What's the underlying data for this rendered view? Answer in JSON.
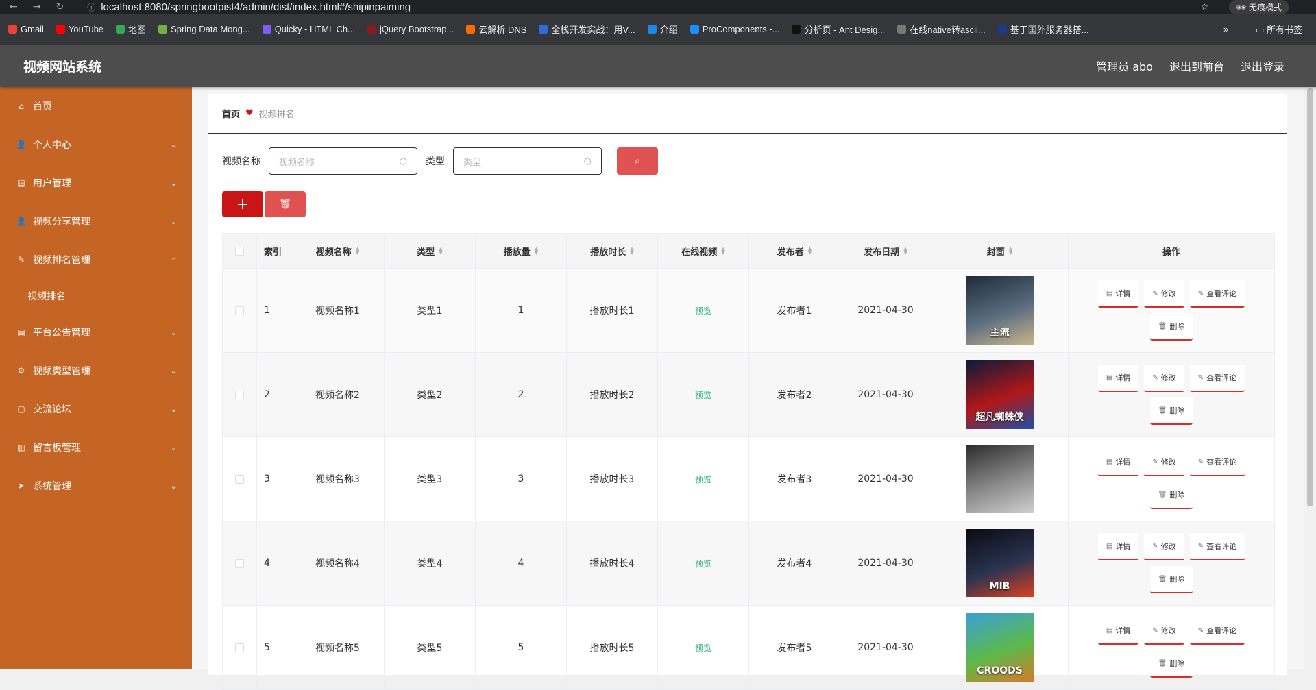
{
  "browser": {
    "url": "localhost:8080/springbootpist4/admin/dist/index.html#/shipinpaiming",
    "incognito_label": "无痕模式",
    "bookmarks": [
      {
        "label": "Gmail",
        "color": "#ea4335"
      },
      {
        "label": "YouTube",
        "color": "#ff0000"
      },
      {
        "label": "地图",
        "color": "#34a853"
      },
      {
        "label": "Spring Data Mong...",
        "color": "#6db33f"
      },
      {
        "label": "Quicky - HTML Ch...",
        "color": "#7b5cf5"
      },
      {
        "label": "jQuery Bootstrap...",
        "color": "#8b1a1a"
      },
      {
        "label": "云解析 DNS",
        "color": "#ff6a00"
      },
      {
        "label": "全栈开发实战：用V...",
        "color": "#2d6cdf"
      },
      {
        "label": "介绍",
        "color": "#1e88e5"
      },
      {
        "label": "ProComponents -...",
        "color": "#1890ff"
      },
      {
        "label": "分析页 - Ant Desig...",
        "color": "#111111"
      },
      {
        "label": "在线native转ascii...",
        "color": "#777777"
      },
      {
        "label": "基于国外服务器搭...",
        "color": "#1a3a8a"
      }
    ],
    "all_bookmarks_label": "所有书签"
  },
  "header": {
    "title": "视频网站系统",
    "admin_label": "管理员 abo",
    "to_front_label": "退出到前台",
    "logout_label": "退出登录"
  },
  "sidebar": {
    "items": [
      {
        "label": "首页",
        "icon": "home-icon",
        "glyph": "⌂",
        "has_children": false
      },
      {
        "label": "个人中心",
        "icon": "user-icon",
        "glyph": "👤",
        "has_children": true
      },
      {
        "label": "用户管理",
        "icon": "id-card-icon",
        "glyph": "▤",
        "has_children": true
      },
      {
        "label": "视频分享管理",
        "icon": "user-icon",
        "glyph": "👤",
        "has_children": true
      },
      {
        "label": "视频排名管理",
        "icon": "edit-icon",
        "glyph": "✎",
        "has_children": true,
        "expanded": true
      },
      {
        "label": "平台公告管理",
        "icon": "notice-icon",
        "glyph": "▤",
        "has_children": true
      },
      {
        "label": "视频类型管理",
        "icon": "settings-icon",
        "glyph": "⚙",
        "has_children": true
      },
      {
        "label": "交流论坛",
        "icon": "chat-icon",
        "glyph": "▢",
        "has_children": true
      },
      {
        "label": "留言板管理",
        "icon": "bar-chart-icon",
        "glyph": "▥",
        "has_children": true
      },
      {
        "label": "系统管理",
        "icon": "send-icon",
        "glyph": "➤",
        "has_children": true
      }
    ],
    "sub_item_label": "视频排名"
  },
  "breadcrumb": {
    "home": "首页",
    "current": "视频排名"
  },
  "search": {
    "name_label": "视频名称",
    "name_placeholder": "视频名称",
    "type_label": "类型",
    "type_placeholder": "类型"
  },
  "table": {
    "headers": {
      "index": "索引",
      "name": "视频名称",
      "type": "类型",
      "plays": "播放量",
      "duration": "播放时长",
      "online": "在线视频",
      "publisher": "发布者",
      "date": "发布日期",
      "cover": "封面",
      "ops": "操作"
    },
    "op_labels": {
      "detail": "详情",
      "edit": "修改",
      "comments": "查看评论",
      "delete": "删除"
    },
    "rows": [
      {
        "index": "1",
        "name": "视频名称1",
        "type": "类型1",
        "plays": "1",
        "duration": "播放时长1",
        "online": "预览",
        "publisher": "发布者1",
        "date": "2021-04-30",
        "cover_text": "主流",
        "cover_colors": [
          "#1e2a38",
          "#5b6d80",
          "#c9b48a"
        ]
      },
      {
        "index": "2",
        "name": "视频名称2",
        "type": "类型2",
        "plays": "2",
        "duration": "播放时长2",
        "online": "预览",
        "publisher": "发布者2",
        "date": "2021-04-30",
        "cover_text": "超凡蜘蛛侠",
        "cover_colors": [
          "#0b1a3a",
          "#b01818",
          "#1e4fa3"
        ]
      },
      {
        "index": "3",
        "name": "视频名称3",
        "type": "类型3",
        "plays": "3",
        "duration": "播放时长3",
        "online": "预览",
        "publisher": "发布者3",
        "date": "2021-04-30",
        "cover_text": "",
        "cover_colors": [
          "#2b2b2b",
          "#8a8a8a",
          "#d0d0d0"
        ]
      },
      {
        "index": "4",
        "name": "视频名称4",
        "type": "类型4",
        "plays": "4",
        "duration": "播放时长4",
        "online": "预览",
        "publisher": "发布者4",
        "date": "2021-04-30",
        "cover_text": "MIB",
        "cover_colors": [
          "#0a0a12",
          "#2a3350",
          "#e04020"
        ]
      },
      {
        "index": "5",
        "name": "视频名称5",
        "type": "类型5",
        "plays": "5",
        "duration": "播放时长5",
        "online": "预览",
        "publisher": "发布者5",
        "date": "2021-04-30",
        "cover_text": "CROODS",
        "cover_colors": [
          "#3aa0d8",
          "#5cb84a",
          "#d87a2a"
        ]
      }
    ]
  }
}
